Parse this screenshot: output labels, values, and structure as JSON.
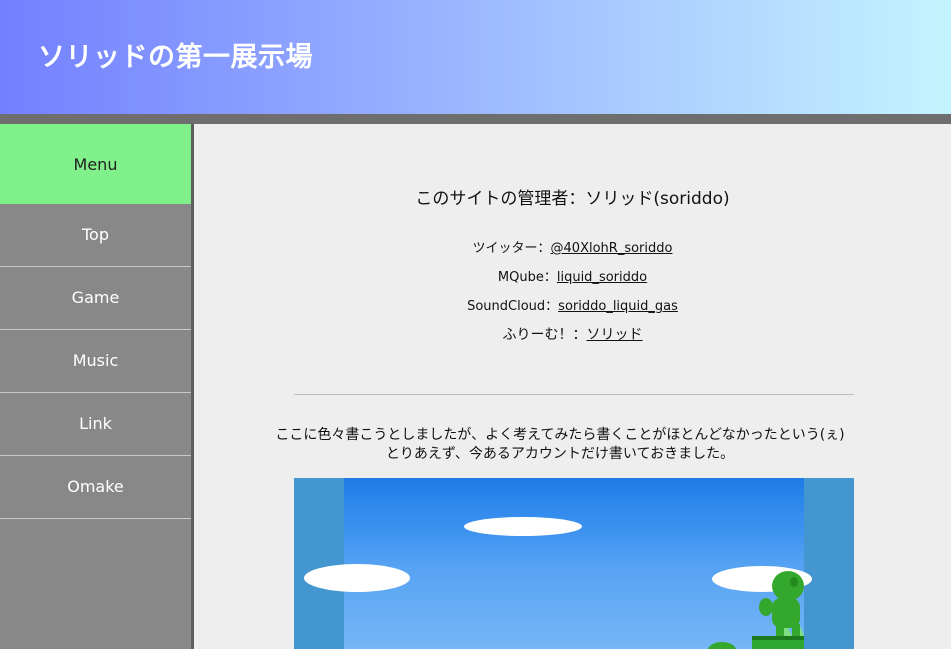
{
  "header": {
    "title": "ソリッドの第一展示場"
  },
  "sidebar": {
    "menu_label": "Menu",
    "items": [
      {
        "label": "Top"
      },
      {
        "label": "Game"
      },
      {
        "label": "Music"
      },
      {
        "label": "Link"
      },
      {
        "label": "Omake"
      }
    ]
  },
  "main": {
    "admin_text": "このサイトの管理者：ソリッド(soriddo)",
    "accounts": [
      {
        "label": "ツイッター：",
        "link": "@40XlohR_soriddo"
      },
      {
        "label": "MQube：",
        "link": "liquid_soriddo"
      },
      {
        "label": "SoundCloud：",
        "link": "soriddo_liquid_gas"
      },
      {
        "label": "ふりーむ！：",
        "link": "ソリッド"
      }
    ],
    "note_lines": [
      "ここに色々書こうとしましたが、よく考えてみたら書くことがほとんどなかったという(ぇ)",
      "とりあえず、今あるアカウントだけ書いておきました。"
    ]
  },
  "colors": {
    "header_gradient": [
      "#7380ff",
      "#c4f4ff"
    ],
    "menu_active": "#80f08a",
    "sidebar": "#888888",
    "content_bg": "#eeeeee"
  }
}
